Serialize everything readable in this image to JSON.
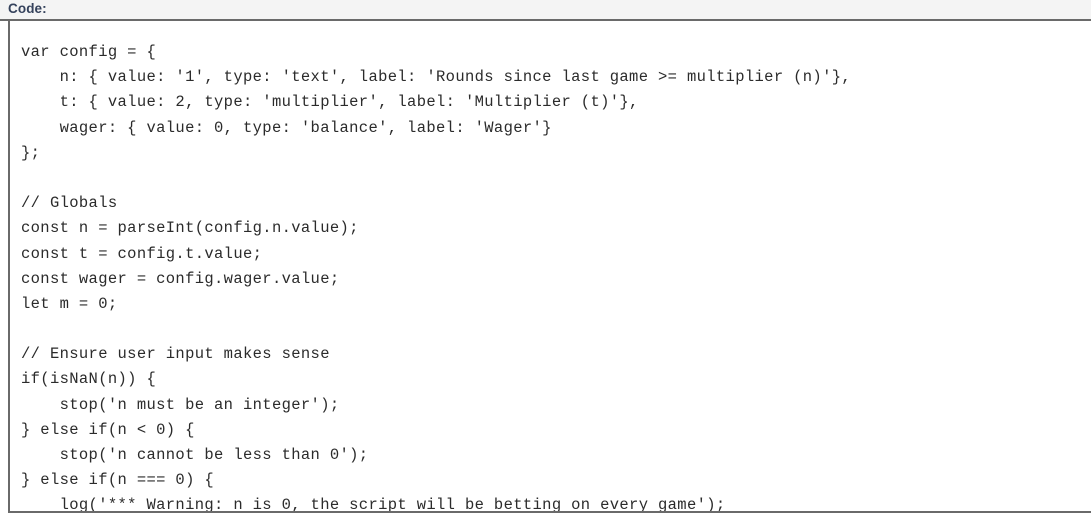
{
  "header": {
    "label": "Code:"
  },
  "colors": {
    "header_band": "#f4f4f4",
    "label_text": "#35425c",
    "box_border": "#6a6a6a",
    "code_text": "#2b2b2b",
    "page_background": "#ffffff"
  },
  "code_block": {
    "language": "javascript",
    "lines": [
      "var config = {",
      "    n: { value: '1', type: 'text', label: 'Rounds since last game >= multiplier (n)'},",
      "    t: { value: 2, type: 'multiplier', label: 'Multiplier (t)'},",
      "    wager: { value: 0, type: 'balance', label: 'Wager'}",
      "};",
      "",
      "// Globals",
      "const n = parseInt(config.n.value);",
      "const t = config.t.value;",
      "const wager = config.wager.value;",
      "let m = 0;",
      "",
      "// Ensure user input makes sense",
      "if(isNaN(n)) {",
      "    stop('n must be an integer');",
      "} else if(n < 0) {",
      "    stop('n cannot be less than 0');",
      "} else if(n === 0) {",
      "    log('*** Warning: n is 0, the script will be betting on every game');"
    ]
  }
}
